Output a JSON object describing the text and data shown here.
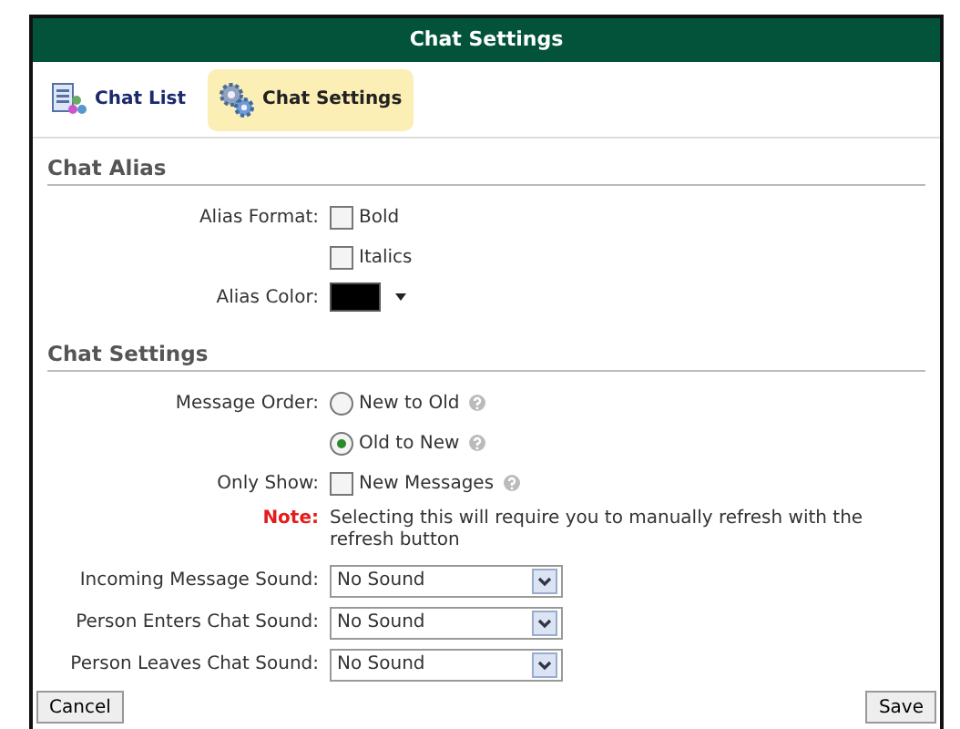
{
  "window": {
    "title": "Chat Settings"
  },
  "tabs": [
    {
      "label": "Chat List",
      "selected": false,
      "kind": "list"
    },
    {
      "label": "Chat Settings",
      "selected": true,
      "kind": "gears"
    }
  ],
  "chat_alias": {
    "heading": "Chat Alias",
    "format_label": "Alias Format:",
    "format_options": [
      {
        "label": "Bold",
        "checked": false
      },
      {
        "label": "Italics",
        "checked": false
      }
    ],
    "color_label": "Alias Color:",
    "color": "#000000"
  },
  "chat_settings": {
    "heading": "Chat Settings",
    "message_order": {
      "label": "Message Order:",
      "options": [
        {
          "label": "New to Old",
          "selected": false
        },
        {
          "label": "Old to New",
          "selected": true
        }
      ]
    },
    "only_show": {
      "label": "Only Show:",
      "option": "New Messages",
      "checked": false
    },
    "note": {
      "label": "Note:",
      "text": "Selecting this will require you to manually refresh with the refresh button"
    },
    "sounds": [
      {
        "label": "Incoming Message Sound:",
        "value": "No Sound"
      },
      {
        "label": "Person Enters Chat Sound:",
        "value": "No Sound"
      },
      {
        "label": "Person Leaves Chat Sound:",
        "value": "No Sound"
      }
    ]
  },
  "buttons": {
    "cancel": "Cancel",
    "save": "Save"
  }
}
